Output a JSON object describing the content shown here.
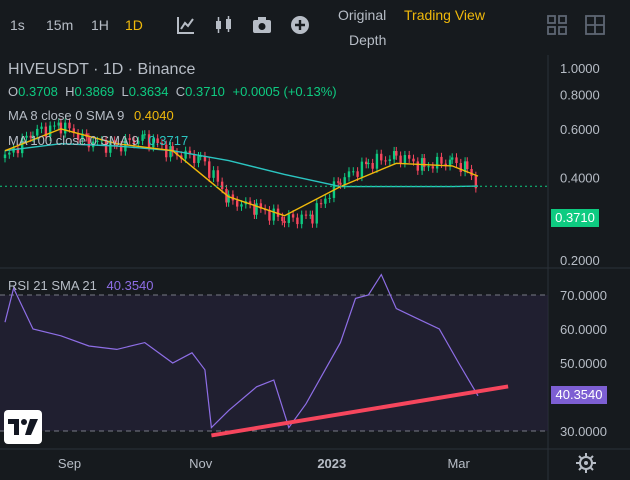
{
  "toolbar": {
    "intervals": [
      "1s",
      "15m",
      "1H",
      "1D"
    ],
    "active_interval": "1D",
    "views": {
      "original": "Original",
      "trading_view": "Trading View",
      "depth": "Depth"
    },
    "active_view": "Trading View",
    "icons": [
      "indicator-icon",
      "candle-type-icon",
      "camera-icon",
      "add-icon",
      "layout-grid-icon",
      "layout-grid-alt-icon"
    ]
  },
  "legend": {
    "symbol": "HIVEUSDT",
    "interval": "1D",
    "exchange": "Binance",
    "ohlc": {
      "o": "0.3708",
      "h": "0.3869",
      "l": "0.3634",
      "c": "0.3710",
      "change": "+0.0005 (+0.13%)"
    },
    "ma8": {
      "label": "MA 8 close 0 SMA 9",
      "value": "0.4040"
    },
    "ma100": {
      "label": "MA 100 close 0 SMA 9",
      "value": "0.3717"
    },
    "rsi": {
      "label": "RSI 21 SMA 21",
      "value": "40.3540"
    }
  },
  "colors": {
    "background": "#161a1e",
    "up": "#0ecb81",
    "down": "#f6465d",
    "ma8": "#f0b90b",
    "ma100": "#2bc5c1",
    "rsi": "#8e6ee6",
    "trendline": "#f6465d",
    "accent": "#f0b90b"
  },
  "price_axis": {
    "ticks": [
      "1.0000",
      "0.8000",
      "0.6000",
      "0.4000",
      "0.2000"
    ],
    "current": "0.3710"
  },
  "rsi_axis": {
    "ticks": [
      "70.0000",
      "60.0000",
      "50.0000",
      "30.0000"
    ],
    "current": "40.3540"
  },
  "time_axis": {
    "labels": [
      "Sep",
      "Nov",
      "2023",
      "Mar"
    ]
  },
  "chart_data": [
    {
      "type": "line",
      "title": "HIVEUSDT · 1D · Binance",
      "y_scale": "log",
      "ylim": [
        0.2,
        1.0
      ],
      "x_range": [
        "2022-08-02",
        "2023-03-10"
      ],
      "series": [
        {
          "name": "HIVEUSDT close",
          "x": [
            "2022-08-02",
            "2022-08-15",
            "2022-08-28",
            "2022-09-10",
            "2022-09-23",
            "2022-10-06",
            "2022-10-19",
            "2022-11-01",
            "2022-11-14",
            "2022-11-27",
            "2022-12-10",
            "2022-12-23",
            "2023-01-05",
            "2023-01-18",
            "2023-01-31",
            "2023-02-13",
            "2023-02-26",
            "2023-03-05",
            "2023-03-10"
          ],
          "values": [
            0.47,
            0.58,
            0.62,
            0.54,
            0.52,
            0.56,
            0.49,
            0.47,
            0.33,
            0.31,
            0.28,
            0.29,
            0.39,
            0.45,
            0.48,
            0.44,
            0.46,
            0.43,
            0.371
          ]
        },
        {
          "name": "MA 8",
          "x": [
            "2022-08-02",
            "2022-08-28",
            "2022-09-23",
            "2022-10-19",
            "2022-11-14",
            "2022-12-10",
            "2023-01-05",
            "2023-01-31",
            "2023-02-26",
            "2023-03-10"
          ],
          "values": [
            0.5,
            0.6,
            0.53,
            0.5,
            0.34,
            0.29,
            0.37,
            0.45,
            0.44,
            0.404
          ]
        },
        {
          "name": "MA 100",
          "x": [
            "2022-08-02",
            "2022-08-28",
            "2022-09-23",
            "2022-10-19",
            "2022-11-14",
            "2022-12-10",
            "2023-01-05",
            "2023-01-31",
            "2023-02-26",
            "2023-03-10"
          ],
          "values": [
            0.5,
            0.53,
            0.52,
            0.5,
            0.46,
            0.41,
            0.37,
            0.37,
            0.37,
            0.3717
          ]
        }
      ]
    },
    {
      "type": "line",
      "title": "RSI 21 SMA 21",
      "ylim": [
        26,
        77
      ],
      "series": [
        {
          "name": "RSI 21",
          "x": [
            "2022-08-02",
            "2022-08-06",
            "2022-08-15",
            "2022-08-28",
            "2022-09-10",
            "2022-09-23",
            "2022-10-06",
            "2022-10-19",
            "2022-10-28",
            "2022-11-03",
            "2022-11-06",
            "2022-11-14",
            "2022-11-27",
            "2022-12-05",
            "2022-12-12",
            "2022-12-20",
            "2023-01-05",
            "2023-01-12",
            "2023-01-18",
            "2023-01-24",
            "2023-01-31",
            "2023-02-10",
            "2023-02-20",
            "2023-03-01",
            "2023-03-10"
          ],
          "values": [
            62,
            72,
            60,
            58,
            55,
            54,
            56,
            50,
            53,
            48,
            31,
            36,
            43,
            45,
            31,
            38,
            56,
            69,
            70,
            76,
            66,
            63,
            60,
            50,
            40.354
          ]
        }
      ],
      "reference_lines": [
        70,
        30
      ],
      "trendline": {
        "x": [
          "2022-11-06",
          "2023-03-24"
        ],
        "y": [
          28.7,
          43.1
        ]
      }
    }
  ]
}
